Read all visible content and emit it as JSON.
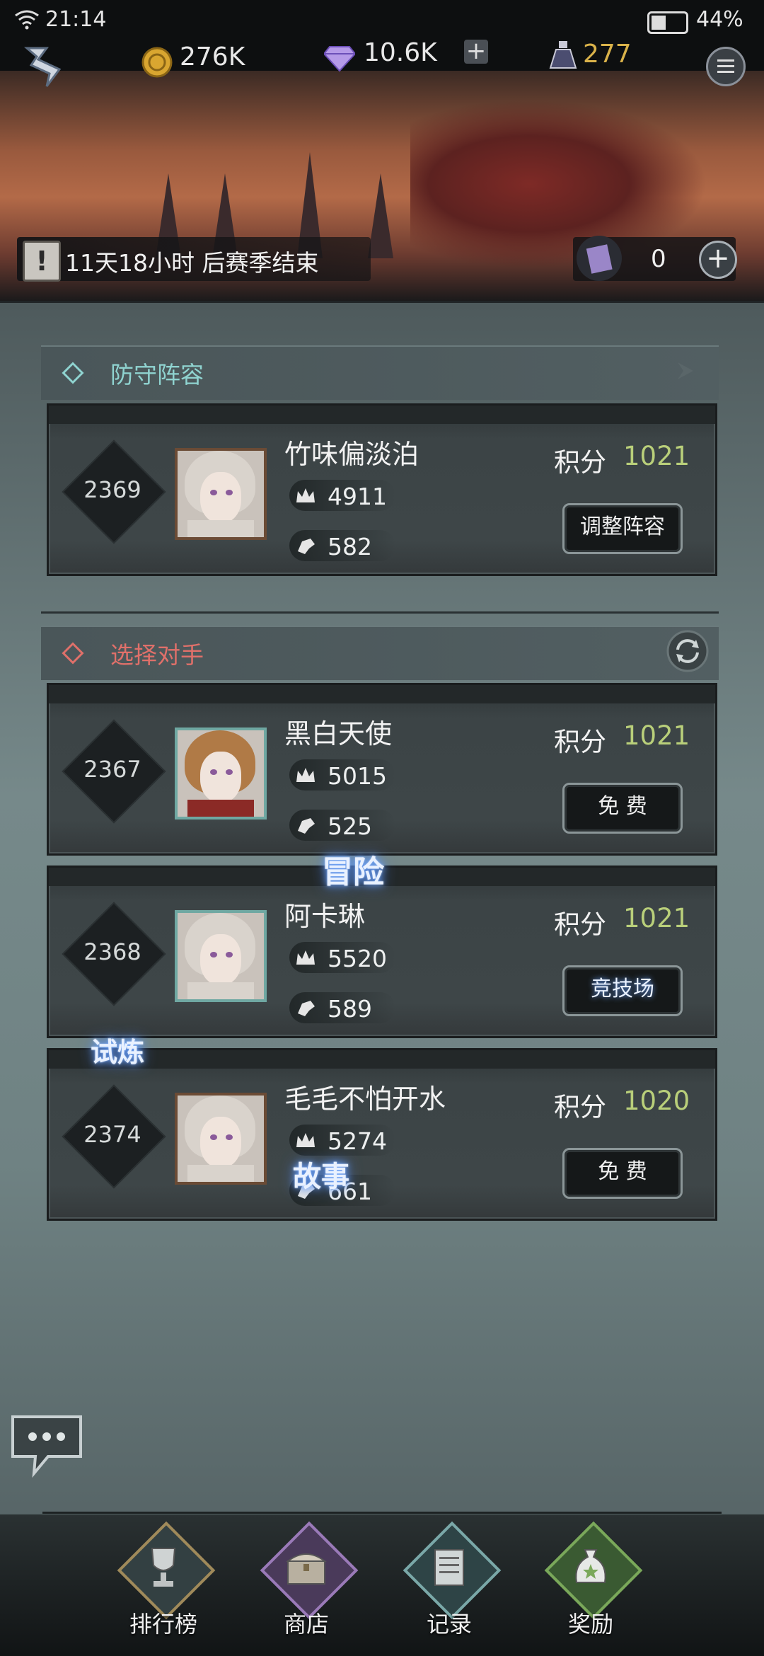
{
  "status_bar": {
    "time": "21:14",
    "battery_pct": "44%"
  },
  "header": {
    "coins": "276K",
    "gems": "10.6K",
    "potion": "277"
  },
  "banner": {
    "season_notice": "11天18小时 后赛季结束",
    "token_count": "0"
  },
  "defense": {
    "title": "防守阵容",
    "card": {
      "rank": "2369",
      "name": "竹味偏淡泊",
      "crown": "4911",
      "power": "582",
      "score_label": "积分",
      "score": "1021",
      "button": "调整阵容"
    }
  },
  "opponents": {
    "title": "选择对手",
    "cards": [
      {
        "rank": "2367",
        "name": "黑白天使",
        "crown": "5015",
        "power": "525",
        "score_label": "积分",
        "score": "1021",
        "button": "免 费"
      },
      {
        "rank": "2368",
        "name": "阿卡琳",
        "crown": "5520",
        "power": "589",
        "score_label": "积分",
        "score": "1021",
        "button": "竞技场"
      },
      {
        "rank": "2374",
        "name": "毛毛不怕开水",
        "crown": "5274",
        "power": "661",
        "score_label": "积分",
        "score": "1020",
        "button": "免 费"
      }
    ]
  },
  "floating_labels": {
    "adventure": "冒险",
    "trial": "试炼",
    "story": "故事"
  },
  "bottom_nav": [
    {
      "label": "排行榜",
      "icon": "trophy-icon"
    },
    {
      "label": "商店",
      "icon": "chest-icon"
    },
    {
      "label": "记录",
      "icon": "scroll-icon"
    },
    {
      "label": "奖励",
      "icon": "reward-bag-icon"
    }
  ],
  "colors": {
    "score_green": "#b9cf7a",
    "defense_title": "#8fd3d0",
    "opponent_title": "#e0706a",
    "potion_gold": "#d9b24a"
  }
}
